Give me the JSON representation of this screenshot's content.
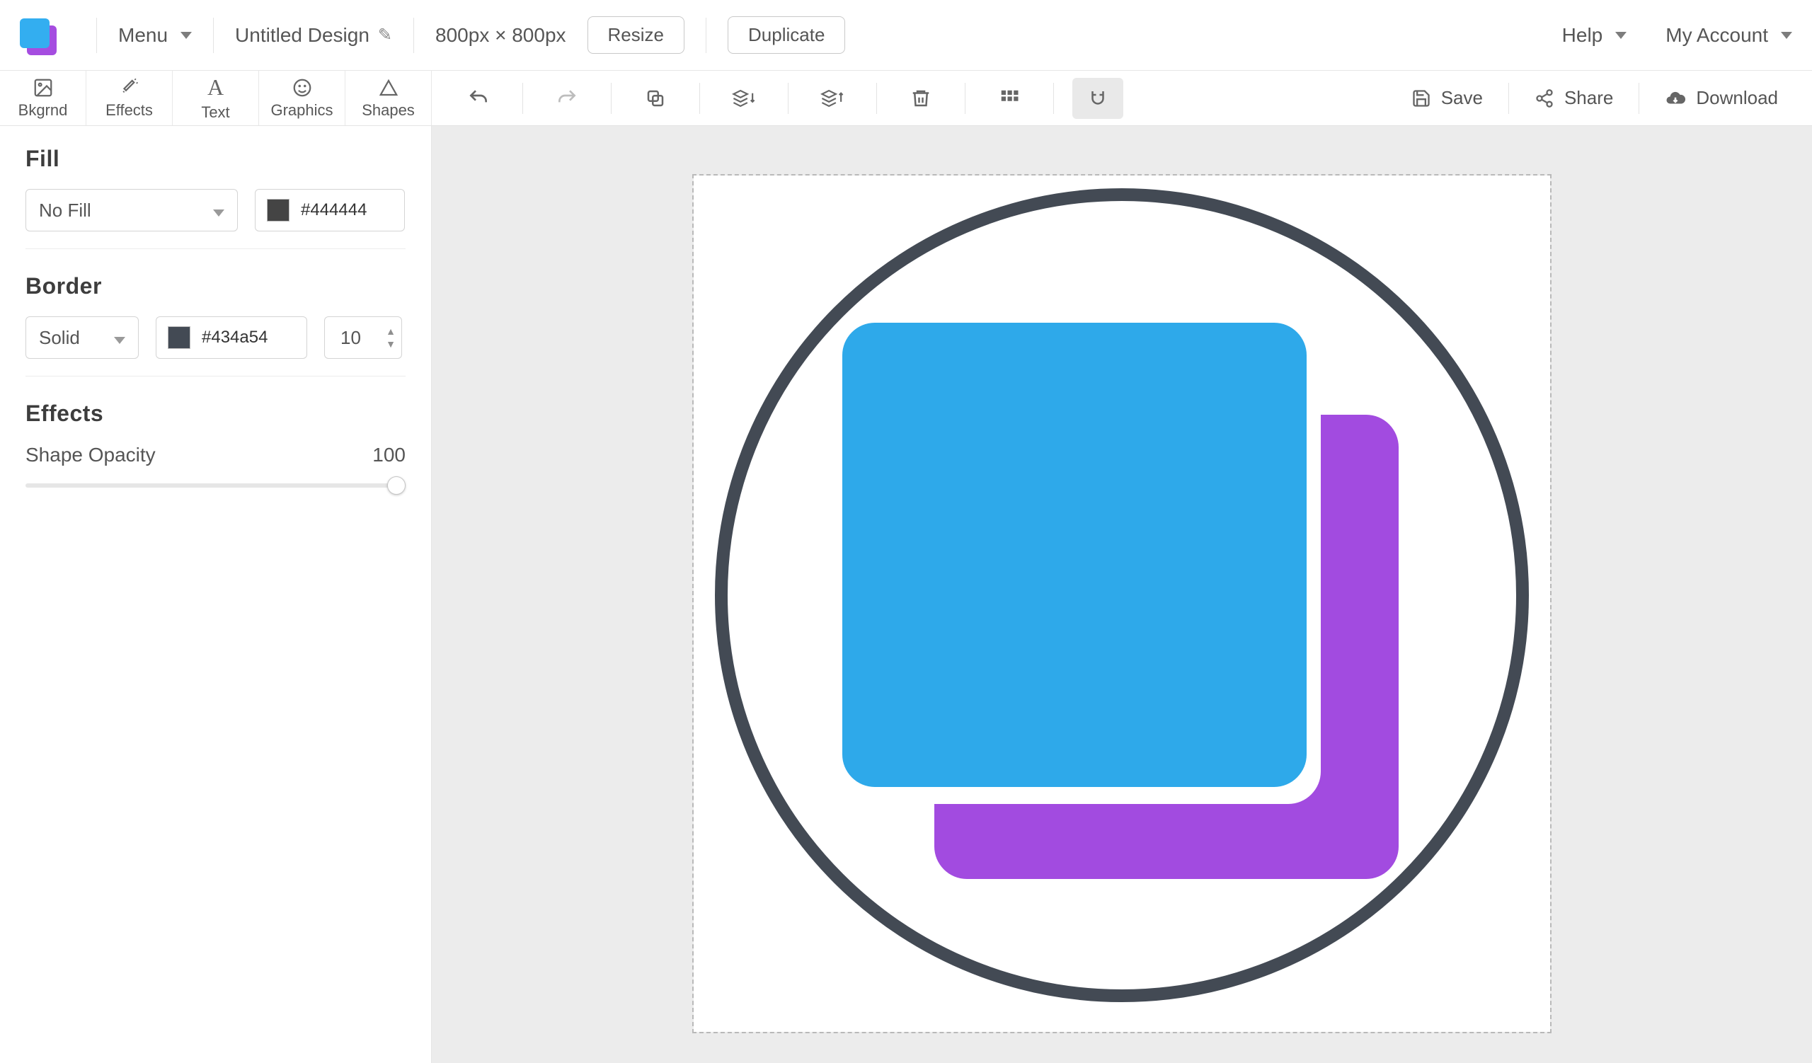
{
  "topbar": {
    "menu_label": "Menu",
    "design_title": "Untitled Design",
    "dimensions": "800px × 800px",
    "resize_label": "Resize",
    "duplicate_label": "Duplicate",
    "help_label": "Help",
    "account_label": "My Account"
  },
  "tool_tabs": {
    "bkgrnd": "Bkgrnd",
    "effects": "Effects",
    "text": "Text",
    "graphics": "Graphics",
    "shapes": "Shapes"
  },
  "toolbar_right": {
    "save_label": "Save",
    "share_label": "Share",
    "download_label": "Download"
  },
  "panel": {
    "fill": {
      "title": "Fill",
      "mode": "No Fill",
      "color_hex": "#444444"
    },
    "border": {
      "title": "Border",
      "style": "Solid",
      "color_hex": "#434a54",
      "width": "10"
    },
    "effects": {
      "title": "Effects",
      "opacity_label": "Shape Opacity",
      "opacity_value": "100"
    }
  }
}
